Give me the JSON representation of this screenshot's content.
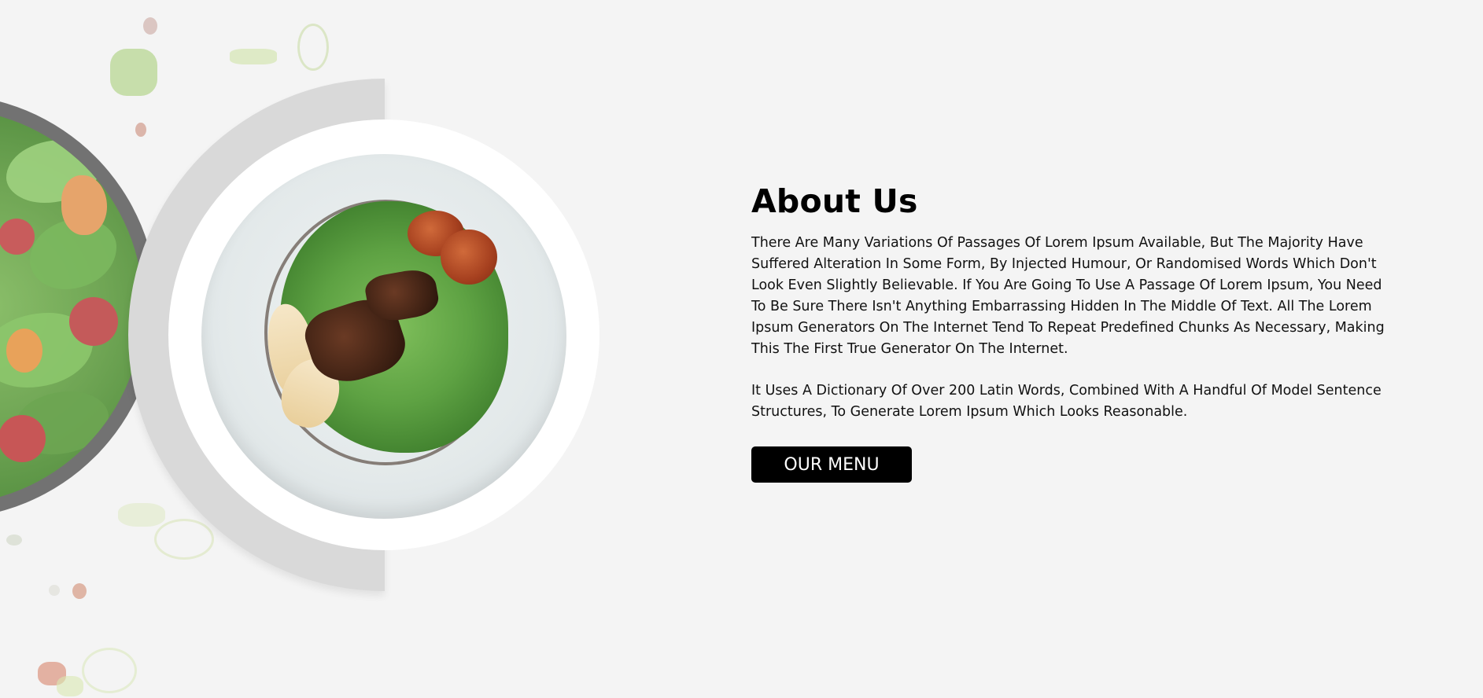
{
  "about": {
    "title": "About Us",
    "paragraphs": [
      "There Are Many Variations Of Passages Of Lorem Ipsum Available, But The Majority Have Suffered Alteration In Some Form, By Injected Humour, Or Randomised Words Which Don't Look Even Slightly Believable. If You Are Going To Use A Passage Of Lorem Ipsum, You Need To Be Sure There Isn't Anything Embarrassing Hidden In The Middle Of Text. All The Lorem Ipsum Generators On The Internet Tend To Repeat Predefined Chunks As Necessary, Making This The First True Generator On The Internet.",
      "It Uses A Dictionary Of Over 200 Latin Words, Combined With A Handful Of Model Sentence Structures, To Generate Lorem Ipsum Which Looks Reasonable."
    ],
    "button_label": "OUR MENU"
  },
  "theme": {
    "background": "#f4f4f4",
    "text": "#000000",
    "button_bg": "#000000",
    "button_text": "#ffffff",
    "half_disc": "#d9d9d9"
  }
}
